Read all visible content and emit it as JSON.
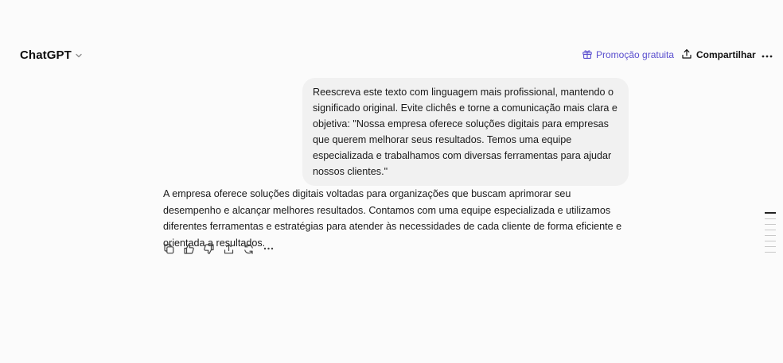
{
  "header": {
    "model_name": "ChatGPT",
    "promo_label": "Promoção gratuita",
    "share_label": "Compartilhar",
    "icons": {
      "model_dropdown": "chevron-down-icon",
      "promo": "gift-icon",
      "share": "share-icon",
      "more": "more-horizontal-icon"
    }
  },
  "conversation": {
    "user_message": "Reescreva este texto com linguagem mais profissional, mantendo o significado original. Evite clichês e torne a comunicação mais clara e objetiva: \"Nossa empresa oferece soluções digitais para empresas que querem melhorar seus resultados. Temos uma equipe especializada e trabalhamos com diversas ferramentas para ajudar nossos clientes.\"",
    "assistant_message": "A empresa oferece soluções digitais voltadas para organizações que buscam aprimorar seu desempenho e alcançar melhores resultados. Contamos com uma equipe especializada e utilizamos diferentes ferramentas e estratégias para atender às necessidades de cada cliente de forma eficiente e orientada a resultados.",
    "actions": [
      "copy-icon",
      "thumbs-up-icon",
      "thumbs-down-icon",
      "share-icon",
      "regenerate-icon",
      "more-horizontal-icon"
    ]
  },
  "colors": {
    "background": "#fbfbfb",
    "bubble": "#f1f1f1",
    "promo_accent": "#5a4fcf",
    "text": "#0d0d0d"
  }
}
